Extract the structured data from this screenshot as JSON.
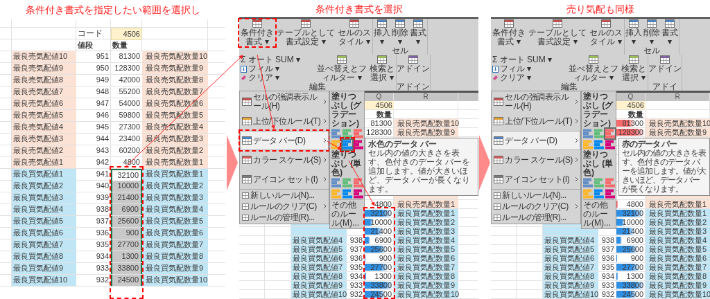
{
  "panels": [
    {
      "kind": "sheet",
      "caption": "条件付き書式を指定したい範囲を選択し",
      "sheet": {
        "code_label": "コード",
        "code_value": "4506",
        "headers": [
          "値段",
          "数量"
        ],
        "callout": true,
        "rows": [
          {
            "kind": "sell",
            "label": "最良売気配値10",
            "price": "951",
            "qty": "81300",
            "qty_label": "最良売気配数量10",
            "selected": false,
            "active": false
          },
          {
            "kind": "sell",
            "label": "最良売気配値9",
            "price": "950",
            "qty": "128300",
            "qty_label": "最良売気配数量9",
            "selected": false,
            "active": false
          },
          {
            "kind": "sell",
            "label": "最良売気配値8",
            "price": "949",
            "qty": "42000",
            "qty_label": "最良売気配数量8",
            "selected": false,
            "active": false
          },
          {
            "kind": "sell",
            "label": "最良売気配値7",
            "price": "948",
            "qty": "55200",
            "qty_label": "最良売気配数量7",
            "selected": false,
            "active": false
          },
          {
            "kind": "sell",
            "label": "最良売気配値6",
            "price": "947",
            "qty": "54000",
            "qty_label": "最良売気配数量6",
            "selected": false,
            "active": false
          },
          {
            "kind": "sell",
            "label": "最良売気配値5",
            "price": "946",
            "qty": "59800",
            "qty_label": "最良売気配数量5",
            "selected": false,
            "active": false
          },
          {
            "kind": "sell",
            "label": "最良売気配値4",
            "price": "945",
            "qty": "27300",
            "qty_label": "最良売気配数量4",
            "selected": false,
            "active": false
          },
          {
            "kind": "sell",
            "label": "最良売気配値3",
            "price": "944",
            "qty": "23400",
            "qty_label": "最良売気配数量3",
            "selected": false,
            "active": false
          },
          {
            "kind": "sell",
            "label": "最良売気配値2",
            "price": "943",
            "qty": "60200",
            "qty_label": "最良売気配数量2",
            "selected": false,
            "active": false
          },
          {
            "kind": "sell",
            "label": "最良売気配値1",
            "price": "942",
            "qty": "4800",
            "qty_label": "最良売気配数量1",
            "selected": false,
            "active": false
          },
          {
            "kind": "buy",
            "label": "最良買気配値1",
            "price": "941",
            "qty": "32100",
            "qty_label": "最良買気配数量1",
            "selected": true,
            "active": true
          },
          {
            "kind": "buy",
            "label": "最良買気配値2",
            "price": "940",
            "qty": "10000",
            "qty_label": "最良買気配数量2",
            "selected": true,
            "active": false
          },
          {
            "kind": "buy",
            "label": "最良買気配値3",
            "price": "939",
            "qty": "21400",
            "qty_label": "最良買気配数量3",
            "selected": true,
            "active": false
          },
          {
            "kind": "buy",
            "label": "最良買気配値4",
            "price": "938",
            "qty": "6900",
            "qty_label": "最良買気配数量4",
            "selected": true,
            "active": false
          },
          {
            "kind": "buy",
            "label": "最良買気配値5",
            "price": "937",
            "qty": "25600",
            "qty_label": "最良買気配数量5",
            "selected": true,
            "active": false
          },
          {
            "kind": "buy",
            "label": "最良買気配値6",
            "price": "936",
            "qty": "900",
            "qty_label": "最良買気配数量6",
            "selected": true,
            "active": false
          },
          {
            "kind": "buy",
            "label": "最良買気配値7",
            "price": "935",
            "qty": "27700",
            "qty_label": "最良買気配数量7",
            "selected": true,
            "active": false
          },
          {
            "kind": "buy",
            "label": "最良買気配値8",
            "price": "934",
            "qty": "1300",
            "qty_label": "最良買気配数量8",
            "selected": true,
            "active": false
          },
          {
            "kind": "buy",
            "label": "最良買気配値9",
            "price": "933",
            "qty": "33800",
            "qty_label": "最良買気配数量9",
            "selected": true,
            "active": false
          },
          {
            "kind": "buy",
            "label": "最良買気配値10",
            "price": "932",
            "qty": "24500",
            "qty_label": "最良買気配数量10",
            "selected": true,
            "active": false
          }
        ]
      }
    },
    {
      "kind": "menu",
      "caption": "条件付き書式を選択",
      "ribbon": {
        "groups": [
          {
            "items": [
              {
                "kind": "large",
                "label": "条件付き書式 ▾",
                "callout": true
              },
              {
                "kind": "large",
                "label": "テーブルとして書式設定 ▾",
                "callout": false
              },
              {
                "kind": "large",
                "label": "セルのスタイル ▾",
                "callout": false
              }
            ]
          },
          {
            "label": "セル",
            "items": [
              {
                "kind": "large",
                "label": "挿入▾",
                "callout": false
              },
              {
                "kind": "large",
                "label": "削除▾",
                "callout": false
              },
              {
                "kind": "large",
                "label": "書式▾",
                "callout": false
              }
            ]
          },
          {
            "label": "編集",
            "items": [
              {
                "kind": "stack",
                "lines": [
                  "Σ オート SUM ▾",
                  "フィル ▾",
                  "クリア ▾"
                ]
              },
              {
                "kind": "large",
                "label": "並べ替えとフィルター ▾",
                "callout": false
              },
              {
                "kind": "large",
                "label": "検索と選択 ▾",
                "callout": false
              }
            ]
          },
          {
            "label": "アドイン",
            "items": [
              {
                "kind": "large",
                "label": "アドイン",
                "callout": false
              }
            ]
          }
        ]
      },
      "menu": [
        {
          "kind": "large",
          "label": "セルの強調表示ルール(H)",
          "submenu": true,
          "selected": false,
          "callout": false
        },
        {
          "kind": "large",
          "label": "上位/下位ルール(T)",
          "submenu": true,
          "selected": false,
          "callout": false
        },
        {
          "kind": "large",
          "label": "データ バー(D)",
          "submenu": true,
          "selected": true,
          "callout": true
        },
        {
          "kind": "large",
          "label": "カラー スケール(S)",
          "submenu": true,
          "selected": false,
          "callout": false
        },
        {
          "kind": "large",
          "label": "アイコン セット(I)",
          "submenu": true,
          "selected": false,
          "callout": false
        },
        {
          "kind": "small",
          "label": "新しいルール(N)...",
          "submenu": false,
          "selected": false,
          "callout": false
        },
        {
          "kind": "small",
          "label": "ルールのクリア(C)",
          "submenu": true,
          "selected": false,
          "callout": false
        },
        {
          "kind": "small",
          "label": "ルールの管理(R)...",
          "submenu": false,
          "selected": false,
          "callout": false
        }
      ],
      "submenu": {
        "sections": [
          {
            "heading": "塗りつぶし (グラデーション)",
            "icons": [
              {
                "color": "#638ec6",
                "selected": false,
                "callout": false
              },
              {
                "color": "#63be7b",
                "selected": false,
                "callout": false
              },
              {
                "color": "#f8696b",
                "selected": false,
                "callout": false
              },
              {
                "color": "#ffb628",
                "selected": false,
                "callout": false
              },
              {
                "color": "#008aef",
                "selected": true,
                "callout": true
              },
              {
                "color": "#d6007b",
                "selected": false,
                "callout": false
              }
            ]
          },
          {
            "heading": "塗りつぶし (単色)",
            "icons": [
              {
                "color": "#638ec6",
                "selected": false,
                "callout": false
              },
              {
                "color": "#63be7b",
                "selected": false,
                "callout": false
              },
              {
                "color": "#f8696b",
                "selected": false,
                "callout": false
              },
              {
                "color": "#ffb628",
                "selected": false,
                "callout": false
              },
              {
                "color": "#008aef",
                "selected": false,
                "callout": false
              },
              {
                "color": "#d6007b",
                "selected": false,
                "callout": false
              }
            ]
          }
        ],
        "more": "その他のルール(M)..."
      },
      "tooltip": {
        "title": "水色のデータ バー",
        "body": "セル内の値の大きさを表す、色付きのデータ バーを追加します。値が大きいほど、データ バーが長くなります。"
      },
      "sheet": {
        "columns": [
          "Q",
          "R"
        ],
        "code_value": "4506",
        "header": "数量",
        "callout": true,
        "rows": [
          {
            "kind": "sell",
            "qty": "81300",
            "qty_label": "最良売気配数量10"
          },
          {
            "kind": "sell",
            "qty": "128300",
            "qty_label": "最良売気配数量9"
          },
          {
            "kind": "sell"
          },
          {
            "kind": "sell"
          },
          {
            "kind": "sell"
          },
          {
            "kind": "sell"
          },
          {
            "kind": "sell"
          },
          {
            "kind": "sell"
          },
          {
            "kind": "sell"
          },
          {
            "kind": "sell",
            "qty": "4800",
            "qty_label": "最良売気配数量1"
          },
          {
            "kind": "buy",
            "qty": "32100",
            "qty_label": "最良買気配数量1",
            "bar": {
              "level": 0.95,
              "color": "#2f8fe3"
            }
          },
          {
            "kind": "buy",
            "qty": "10000",
            "qty_label": "最良買気配数量2",
            "bar": {
              "level": 0.3,
              "color": "#2f8fe3"
            }
          },
          {
            "kind": "buy",
            "qty": "21400",
            "qty_label": "最良買気配数量3",
            "bar": {
              "level": 0.63,
              "color": "#2f8fe3"
            }
          },
          {
            "kind": "buy",
            "label": "最良買気配値4",
            "price": "938",
            "qty": "6900",
            "qty_label": "最良買気配数量4",
            "bar": {
              "level": 0.2,
              "color": "#2f8fe3"
            }
          },
          {
            "kind": "buy",
            "label": "最良買気配値5",
            "price": "937",
            "qty": "25600",
            "qty_label": "最良買気配数量5",
            "bar": {
              "level": 0.76,
              "color": "#2f8fe3"
            }
          },
          {
            "kind": "buy",
            "label": "最良買気配値6",
            "price": "936",
            "qty": "900",
            "qty_label": "最良買気配数量6",
            "bar": {
              "level": 0.03,
              "color": "#2f8fe3"
            }
          },
          {
            "kind": "buy",
            "label": "最良買気配値7",
            "price": "935",
            "qty": "27700",
            "qty_label": "最良買気配数量7",
            "bar": {
              "level": 0.82,
              "color": "#2f8fe3"
            }
          },
          {
            "kind": "buy",
            "label": "最良買気配値8",
            "price": "934",
            "qty": "1300",
            "qty_label": "最良買気配数量8",
            "bar": {
              "level": 0.04,
              "color": "#2f8fe3"
            }
          },
          {
            "kind": "buy",
            "label": "最良買気配値9",
            "price": "933",
            "qty": "33800",
            "qty_label": "最良買気配数量9",
            "bar": {
              "level": 1,
              "color": "#2f8fe3"
            }
          },
          {
            "kind": "buy",
            "label": "最良買気配値10",
            "price": "932",
            "qty": "24500",
            "qty_label": "最良買気配数量10",
            "bar": {
              "level": 0.72,
              "color": "#2f8fe3"
            }
          }
        ]
      }
    },
    {
      "kind": "menu",
      "caption": "売り気配も同様",
      "ribbon": {
        "groups": [
          {
            "items": [
              {
                "kind": "large",
                "label": "条件付き書式 ▾",
                "callout": false
              },
              {
                "kind": "large",
                "label": "テーブルとして書式設定 ▾",
                "callout": false
              },
              {
                "kind": "large",
                "label": "セルのスタイル ▾",
                "callout": false
              }
            ]
          },
          {
            "label": "セル",
            "items": [
              {
                "kind": "large",
                "label": "挿入▾",
                "callout": false
              },
              {
                "kind": "large",
                "label": "削除▾",
                "callout": false
              },
              {
                "kind": "large",
                "label": "書式▾",
                "callout": false
              }
            ]
          },
          {
            "label": "編集",
            "items": [
              {
                "kind": "stack",
                "lines": [
                  "Σ オート SUM ▾",
                  "フィル ▾",
                  "クリア ▾"
                ]
              },
              {
                "kind": "large",
                "label": "並べ替えとフィルター ▾",
                "callout": false
              },
              {
                "kind": "large",
                "label": "検索と選択 ▾",
                "callout": false
              }
            ]
          },
          {
            "label": "アドイ",
            "items": [
              {
                "kind": "large",
                "label": "アドイン",
                "callout": false
              }
            ]
          }
        ]
      },
      "menu": [
        {
          "kind": "large",
          "label": "セルの強調表示ルール(H)",
          "submenu": true,
          "selected": false,
          "callout": false
        },
        {
          "kind": "large",
          "label": "上位/下位ルール(T)",
          "submenu": true,
          "selected": false,
          "callout": false
        },
        {
          "kind": "large",
          "label": "データ バー(D)",
          "submenu": true,
          "selected": true,
          "callout": false
        },
        {
          "kind": "large",
          "label": "カラー スケール(S)",
          "submenu": true,
          "selected": false,
          "callout": false
        },
        {
          "kind": "large",
          "label": "アイコン セット(I)",
          "submenu": true,
          "selected": false,
          "callout": false
        },
        {
          "kind": "small",
          "label": "新しいルール(N)...",
          "submenu": false,
          "selected": false,
          "callout": false
        },
        {
          "kind": "small",
          "label": "ルールのクリア(C)",
          "submenu": true,
          "selected": false,
          "callout": false
        },
        {
          "kind": "small",
          "label": "ルールの管理(R)...",
          "submenu": false,
          "selected": false,
          "callout": false
        }
      ],
      "submenu": {
        "sections": [
          {
            "heading": "塗りつぶし (グラデーション)",
            "icons": [
              {
                "color": "#638ec6",
                "selected": false,
                "callout": false
              },
              {
                "color": "#63be7b",
                "selected": false,
                "callout": false
              },
              {
                "color": "#f8696b",
                "selected": true,
                "callout": false
              },
              {
                "color": "#ffb628",
                "selected": false,
                "callout": false
              },
              {
                "color": "#008aef",
                "selected": false,
                "callout": false
              },
              {
                "color": "#d6007b",
                "selected": false,
                "callout": false
              }
            ]
          },
          {
            "heading": "塗りつぶし (単色)",
            "icons": [
              {
                "color": "#638ec6",
                "selected": false,
                "callout": false
              },
              {
                "color": "#63be7b",
                "selected": false,
                "callout": false
              },
              {
                "color": "#f8696b",
                "selected": false,
                "callout": false
              },
              {
                "color": "#ffb628",
                "selected": false,
                "callout": false
              },
              {
                "color": "#008aef",
                "selected": false,
                "callout": false
              },
              {
                "color": "#d6007b",
                "selected": false,
                "callout": false
              }
            ]
          }
        ],
        "more": "その他のルール(M)..."
      },
      "tooltip": {
        "title": "赤のデータ バー",
        "body": "セル内の値の大きさを表す、色付きのデータ バーを追加します。値が大きいほど、データ バーが長くなります。"
      },
      "sheet": {
        "columns": [
          "Q",
          "R"
        ],
        "code_value": "4506",
        "header": "数量",
        "rows": [
          {
            "kind": "sell",
            "qty": "81300",
            "qty_label": "最良売気配数量10",
            "bar": {
              "level": 0.63,
              "color": "#f8696b"
            }
          },
          {
            "kind": "sell",
            "qty": "128300",
            "qty_label": "最良売気配数量9",
            "bar": {
              "level": 1,
              "color": "#f8696b"
            }
          },
          {
            "kind": "sell"
          },
          {
            "kind": "sell"
          },
          {
            "kind": "sell"
          },
          {
            "kind": "sell"
          },
          {
            "kind": "sell"
          },
          {
            "kind": "sell"
          },
          {
            "kind": "sell"
          },
          {
            "kind": "sell",
            "qty": "4800",
            "qty_label": "最良売気配数量1",
            "bar": {
              "level": 0.04,
              "color": "#f8696b"
            }
          },
          {
            "kind": "buy",
            "qty": "32100",
            "qty_label": "最良買気配数量1",
            "bar": {
              "level": 0.95,
              "color": "#2f8fe3"
            }
          },
          {
            "kind": "buy",
            "qty": "10000",
            "qty_label": "最良買気配数量2",
            "bar": {
              "level": 0.3,
              "color": "#2f8fe3"
            }
          },
          {
            "kind": "buy",
            "qty": "21400",
            "qty_label": "最良買気配数量3",
            "bar": {
              "level": 0.63,
              "color": "#2f8fe3"
            }
          },
          {
            "kind": "buy",
            "label": "最良買気配値4",
            "price": "938",
            "qty": "6900",
            "qty_label": "最良買気配数量4",
            "bar": {
              "level": 0.2,
              "color": "#2f8fe3"
            }
          },
          {
            "kind": "buy",
            "label": "最良買気配値5",
            "price": "937",
            "qty": "25600",
            "qty_label": "最良買気配数量5",
            "bar": {
              "level": 0.76,
              "color": "#2f8fe3"
            }
          },
          {
            "kind": "buy",
            "label": "最良買気配値6",
            "price": "936",
            "qty": "900",
            "qty_label": "最良買気配数量6",
            "bar": {
              "level": 0.03,
              "color": "#2f8fe3"
            }
          },
          {
            "kind": "buy",
            "label": "最良買気配値7",
            "price": "935",
            "qty": "27700",
            "qty_label": "最良買気配数量7",
            "bar": {
              "level": 0.82,
              "color": "#2f8fe3"
            }
          },
          {
            "kind": "buy",
            "label": "最良買気配値8",
            "price": "934",
            "qty": "1300",
            "qty_label": "最良買気配数量8",
            "bar": {
              "level": 0.04,
              "color": "#2f8fe3"
            }
          },
          {
            "kind": "buy",
            "label": "最良買気配値9",
            "price": "933",
            "qty": "33800",
            "qty_label": "最良買気配数量9",
            "bar": {
              "level": 1,
              "color": "#2f8fe3"
            }
          },
          {
            "kind": "buy",
            "label": "最良買気配値10",
            "price": "932",
            "qty": "24500",
            "qty_label": "最良買気配数量10",
            "bar": {
              "level": 0.72,
              "color": "#2f8fe3"
            }
          }
        ]
      }
    }
  ]
}
